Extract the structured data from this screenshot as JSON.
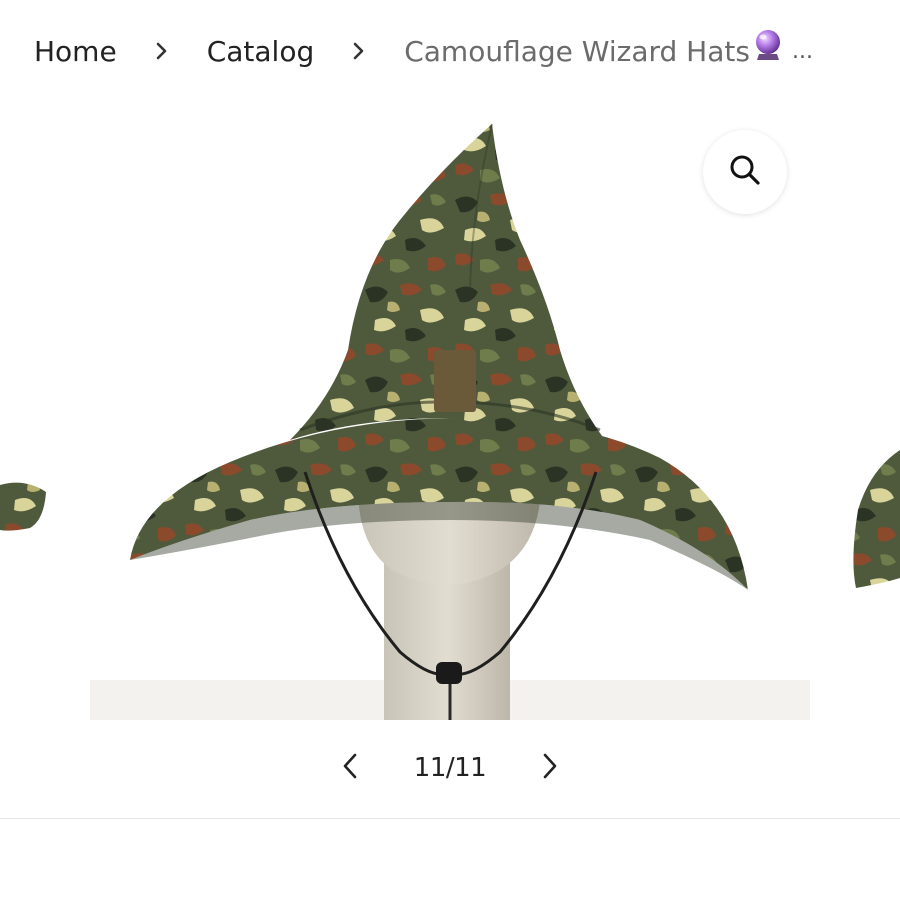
{
  "breadcrumb": {
    "home": "Home",
    "catalog": "Catalog",
    "current": "Camouflage Wizard Hats",
    "ellipsis": "...",
    "separator_icon": "chevron-right-icon",
    "emoji_icon": "crystal-ball-icon"
  },
  "gallery": {
    "image_alt": "Camouflage wizard hat on a mannequin head",
    "zoom_icon": "search-icon"
  },
  "pager": {
    "counter": "11/11",
    "prev_icon": "chevron-left-icon",
    "next_icon": "chevron-right-icon"
  },
  "colors": {
    "text": "#222222",
    "muted": "#6b6b6b",
    "camo_base": "#4f5a3c",
    "camo_dark": "#2b3324",
    "camo_brown": "#8b4a2b",
    "camo_tan": "#d8d49a"
  }
}
